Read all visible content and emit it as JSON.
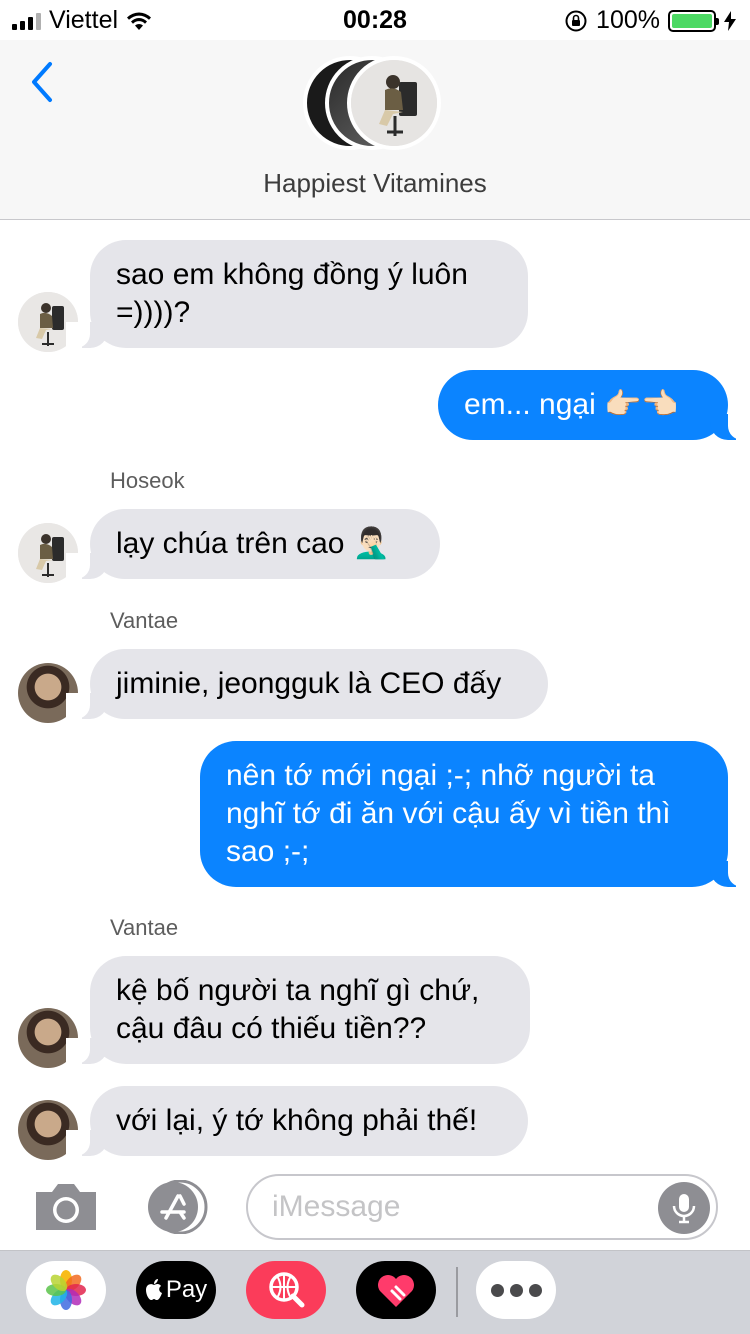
{
  "status_bar": {
    "carrier": "Viettel",
    "time": "00:28",
    "battery": "100%",
    "battery_level": 1.0
  },
  "header": {
    "group_name": "Happiest Vitamines"
  },
  "messages": [
    {
      "direction": "incoming",
      "sender_label": "",
      "text": "sao em không đồng ý luôn =))))?",
      "avatar": "hoseok"
    },
    {
      "direction": "outgoing",
      "text": "em... ngại 👉🏻👈🏻"
    },
    {
      "direction": "incoming",
      "sender_label": "Hoseok",
      "text": "lạy chúa trên cao 🤦🏻‍♂️",
      "avatar": "hoseok"
    },
    {
      "direction": "incoming",
      "sender_label": "Vantae",
      "text": "jiminie, jeongguk là CEO đấy",
      "avatar": "vantae"
    },
    {
      "direction": "outgoing",
      "text": "nên tớ mới ngại ;-; nhỡ người ta nghĩ tớ đi ăn với cậu ấy vì tiền thì sao ;-;"
    },
    {
      "direction": "incoming",
      "sender_label": "Vantae",
      "text": "kệ bố người ta nghĩ gì chứ, cậu đâu có thiếu tiền??",
      "avatar": "vantae"
    },
    {
      "direction": "incoming",
      "sender_label": "",
      "text": "với lại, ý tớ không phải thế!",
      "avatar": "vantae"
    }
  ],
  "input": {
    "placeholder": "iMessage"
  },
  "app_drawer": {
    "apple_pay_label": "Pay",
    "items": [
      "photos-app",
      "apple-pay-app",
      "search-images-app",
      "digital-touch-app",
      "more-apps"
    ]
  },
  "colors": {
    "outgoing_bubble": "#0b84ff",
    "incoming_bubble": "#e5e5ea",
    "accent": "#007aff",
    "battery": "#4cd964"
  }
}
